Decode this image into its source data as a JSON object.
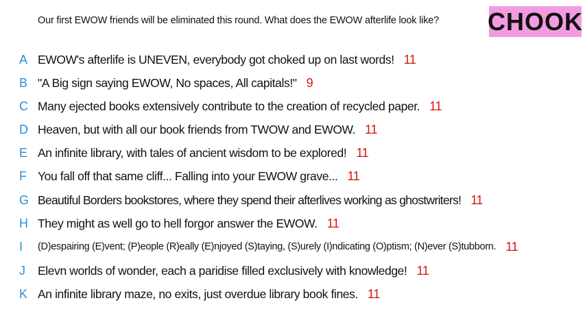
{
  "prompt": "Our first EWOW friends will be eliminated this round. What does the EWOW afterlife look like?",
  "badge": "CHOOK",
  "colors": {
    "badge_bg": "#f39be0",
    "letter": "#2a8fd6",
    "count": "#d8140d"
  },
  "responses": [
    {
      "letter": "A",
      "text": "EWOW's afterlife is UNEVEN, everybody got choked up on last words!",
      "count": "11"
    },
    {
      "letter": "B",
      "text": "\"A Big sign saying EWOW, No spaces, All capitals!\"",
      "count": "9"
    },
    {
      "letter": "C",
      "text": "Many ejected books extensively contribute to the creation of recycled paper.",
      "count": "11"
    },
    {
      "letter": "D",
      "text": "Heaven, but with all our book friends from TWOW and EWOW.",
      "count": "11"
    },
    {
      "letter": "E",
      "text": "An infinite library, with tales of ancient wisdom to be explored!",
      "count": "11"
    },
    {
      "letter": "F",
      "text": "You fall off that same cliff... Falling into your EWOW grave...",
      "count": "11"
    },
    {
      "letter": "G",
      "text": "Beautiful Borders bookstores, where they spend their afterlives working as ghostwriters!",
      "count": "11"
    },
    {
      "letter": "H",
      "text": "They might as well go to hell forgor answer the EWOW.",
      "count": "11"
    },
    {
      "letter": "I",
      "text": "(D)espairing (E)vent; (P)eople (R)eally (E)njoyed (S)taying, (S)urely (I)ndicating (O)ptism; (N)ever (S)tubborn.",
      "count": "11"
    },
    {
      "letter": "J",
      "text": "Elevn worlds of wonder, each a paridise filled exclusively with knowledge!",
      "count": "11"
    },
    {
      "letter": "K",
      "text": "An infinite library maze, no exits, just overdue library book fines.",
      "count": "11"
    }
  ]
}
